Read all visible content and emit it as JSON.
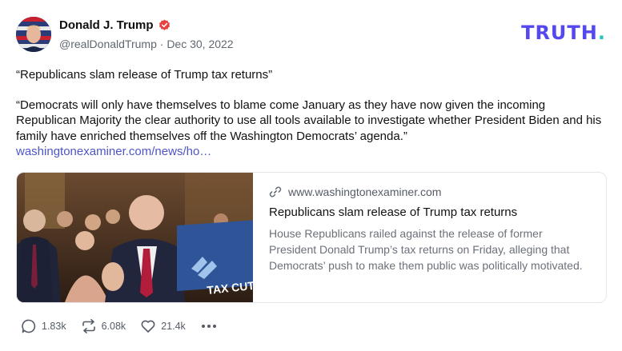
{
  "author": {
    "name": "Donald J. Trump",
    "handle": "@realDonaldTrump",
    "date": "Dec 30, 2022",
    "separator": "·"
  },
  "brand": {
    "logo_text": "TRUTH",
    "logo_dot": ".",
    "primary_color": "#5448ee",
    "dot_color": "#23c9b8"
  },
  "post": {
    "quote_title": "“Republicans slam release of Trump tax returns”",
    "body": "“Democrats will only have themselves to blame come January as they have now given the incoming Republican Majority the clear authority to use all tools available to investigate whether President Biden and his family have enriched themselves off the Washington Democrats’ agenda.”",
    "link": "washingtonexaminer.com/news/ho…"
  },
  "card": {
    "domain": "www.washingtonexaminer.com",
    "title": "Republicans slam release of Trump tax returns",
    "description": "House Republicans railed against the release of former President Donald Trump’s tax returns on Friday, alleging that Democrats’ push to make them public was politically motivated.",
    "image_sign_text": "TAX CUTS"
  },
  "actions": {
    "replies": "1.83k",
    "retruths": "6.08k",
    "likes": "21.4k"
  },
  "icons": [
    "verified-badge-icon",
    "link-icon",
    "reply-icon",
    "retruth-icon",
    "like-icon",
    "more-icon"
  ]
}
